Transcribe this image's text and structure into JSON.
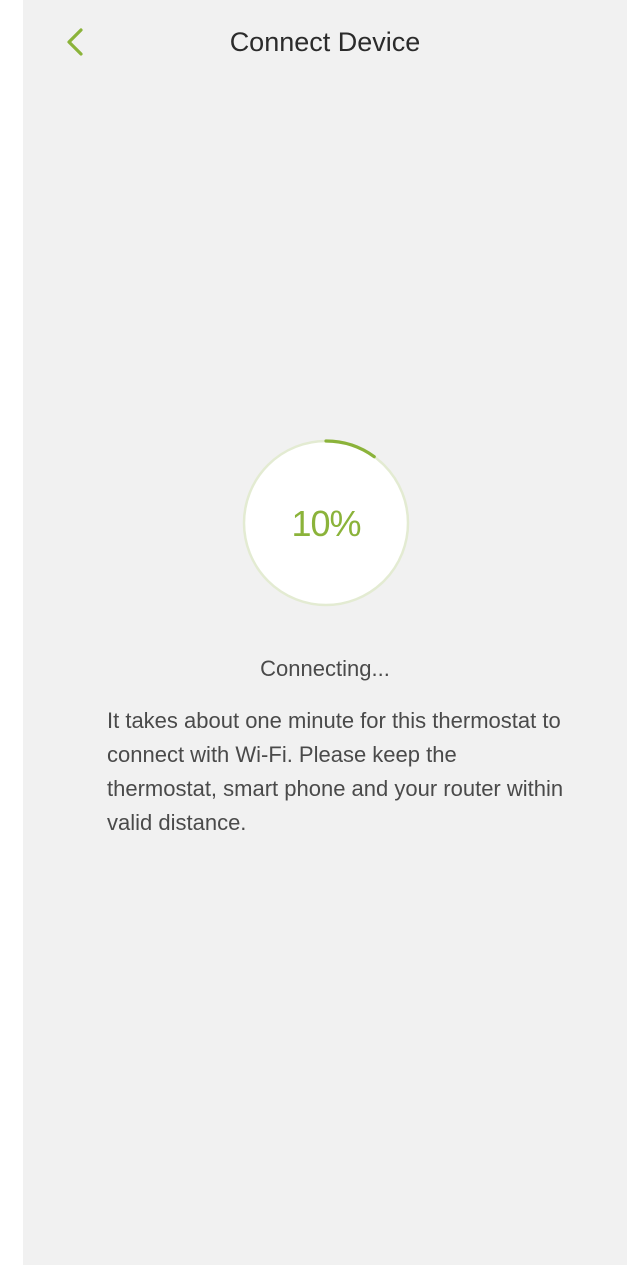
{
  "header": {
    "title": "Connect Device",
    "back_icon": "chevron-left-icon"
  },
  "progress": {
    "percent_text": "10%",
    "value": 0.1,
    "accent_color": "#8bb33a",
    "track_color": "#e3ebd2"
  },
  "status": {
    "text": "Connecting..."
  },
  "message": {
    "text": "It takes about one minute for this thermostat to connect with Wi-Fi. Please keep the thermostat, smart phone and your router within valid distance."
  }
}
